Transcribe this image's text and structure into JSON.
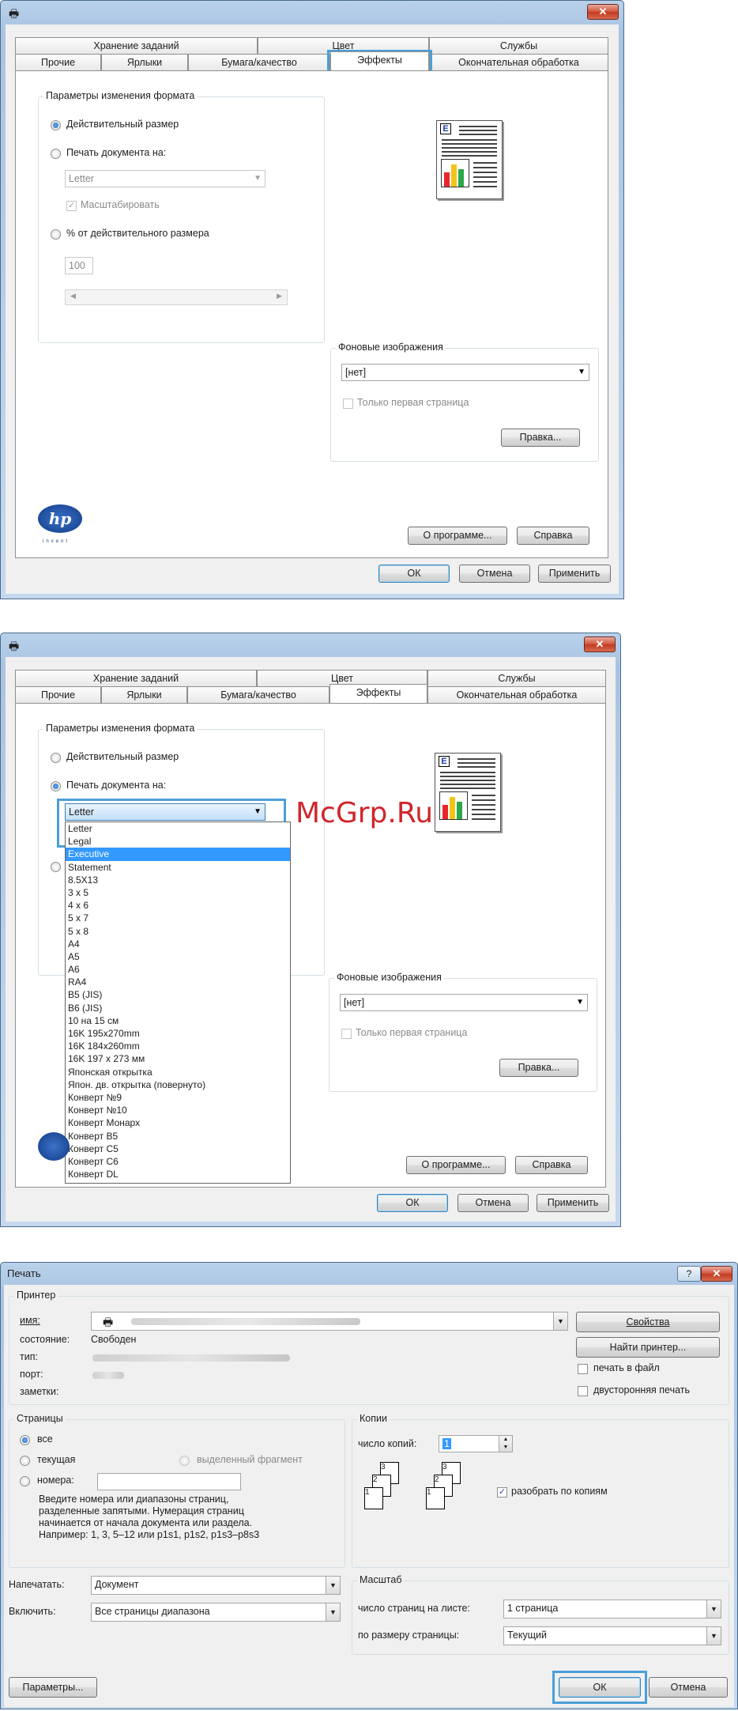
{
  "dialog1": {
    "tabs_back": [
      "Хранение заданий",
      "Цвет",
      "Службы"
    ],
    "tabs_front": [
      "Прочие",
      "Ярлыки",
      "Бумага/качество",
      "Эффекты",
      "Окончательная обработка"
    ],
    "resize_group": {
      "title": "Параметры изменения формата",
      "actual_size": "Действительный размер",
      "print_on": "Печать документа на:",
      "paper": "Letter",
      "scale_to_fit": "Масштабировать",
      "percent": "% от действительного размера",
      "percent_value": "100"
    },
    "watermark_group": {
      "title": "Фоновые изображения",
      "value": "[нет]",
      "first_page_only": "Только первая страница",
      "edit_button": "Правка..."
    },
    "about_button": "О программе...",
    "help_button": "Справка",
    "ok_button": "ОК",
    "cancel_button": "Отмена",
    "apply_button": "Применить",
    "hp_logo": "hp",
    "hp_invent": "invent"
  },
  "dialog2": {
    "tabs_back": [
      "Хранение заданий",
      "Цвет",
      "Службы"
    ],
    "tabs_front": [
      "Прочие",
      "Ярлыки",
      "Бумага/качество",
      "Эффекты",
      "Окончательная обработка"
    ],
    "resize_group": {
      "title": "Параметры изменения формата",
      "actual_size": "Действительный размер",
      "print_on": "Печать документа на:",
      "paper": "Letter"
    },
    "paper_list": [
      "Letter",
      "Legal",
      "Executive",
      "Statement",
      "8.5X13",
      "3 x 5",
      "4 x 6",
      "5 x 7",
      "5 x 8",
      "A4",
      "A5",
      "A6",
      "RA4",
      "B5 (JIS)",
      "B6 (JIS)",
      "10 на 15 см",
      "16K 195x270mm",
      "16K 184x260mm",
      "16K 197 x 273 мм",
      "Японская открытка",
      "Япон. дв. открытка (повернуто)",
      "Конверт №9",
      "Конверт №10",
      "Конверт Монарх",
      "Конверт B5",
      "Конверт C5",
      "Конверт C6",
      "Конверт DL"
    ],
    "paper_list_selected": "Executive",
    "watermark_group": {
      "title": "Фоновые изображения",
      "value": "[нет]",
      "first_page_only": "Только первая страница",
      "edit_button": "Правка..."
    },
    "about_button": "О программе...",
    "help_button": "Справка",
    "ok_button": "ОК",
    "cancel_button": "Отмена",
    "apply_button": "Применить",
    "watermark_text": "McGrp.Ru"
  },
  "dialog3": {
    "title": "Печать",
    "help_glyph": "?",
    "printer": {
      "group": "Принтер",
      "name_label": "имя:",
      "status_label": "состояние:",
      "status_value": "Свободен",
      "type_label": "тип:",
      "port_label": "порт:",
      "notes_label": "заметки:",
      "properties_button": "Свойства",
      "find_button": "Найти принтер...",
      "print_to_file": "печать в файл",
      "duplex": "двусторонняя печать"
    },
    "pages": {
      "group": "Страницы",
      "all": "все",
      "current": "текущая",
      "selection": "выделенный фрагмент",
      "numbers": "номера:",
      "hint": [
        "Введите номера или диапазоны страниц,",
        "разделенные запятыми. Нумерация страниц",
        "начинается от начала документа или раздела.",
        "Например: 1, 3, 5–12 или p1s1, p1s2, p1s3–p8s3"
      ]
    },
    "copies": {
      "group": "Копии",
      "count_label": "число копий:",
      "count_value": "1",
      "collate": "разобрать по копиям"
    },
    "print_what_label": "Напечатать:",
    "print_what_value": "Документ",
    "include_label": "Включить:",
    "include_value": "Все страницы диапазона",
    "zoom": {
      "group": "Масштаб",
      "pages_per_sheet_label": "число страниц на листе:",
      "pages_per_sheet_value": "1 страница",
      "scale_label": "по размеру страницы:",
      "scale_value": "Текущий"
    },
    "options_button": "Параметры...",
    "ok_button": "ОК",
    "cancel_button": "Отмена"
  }
}
